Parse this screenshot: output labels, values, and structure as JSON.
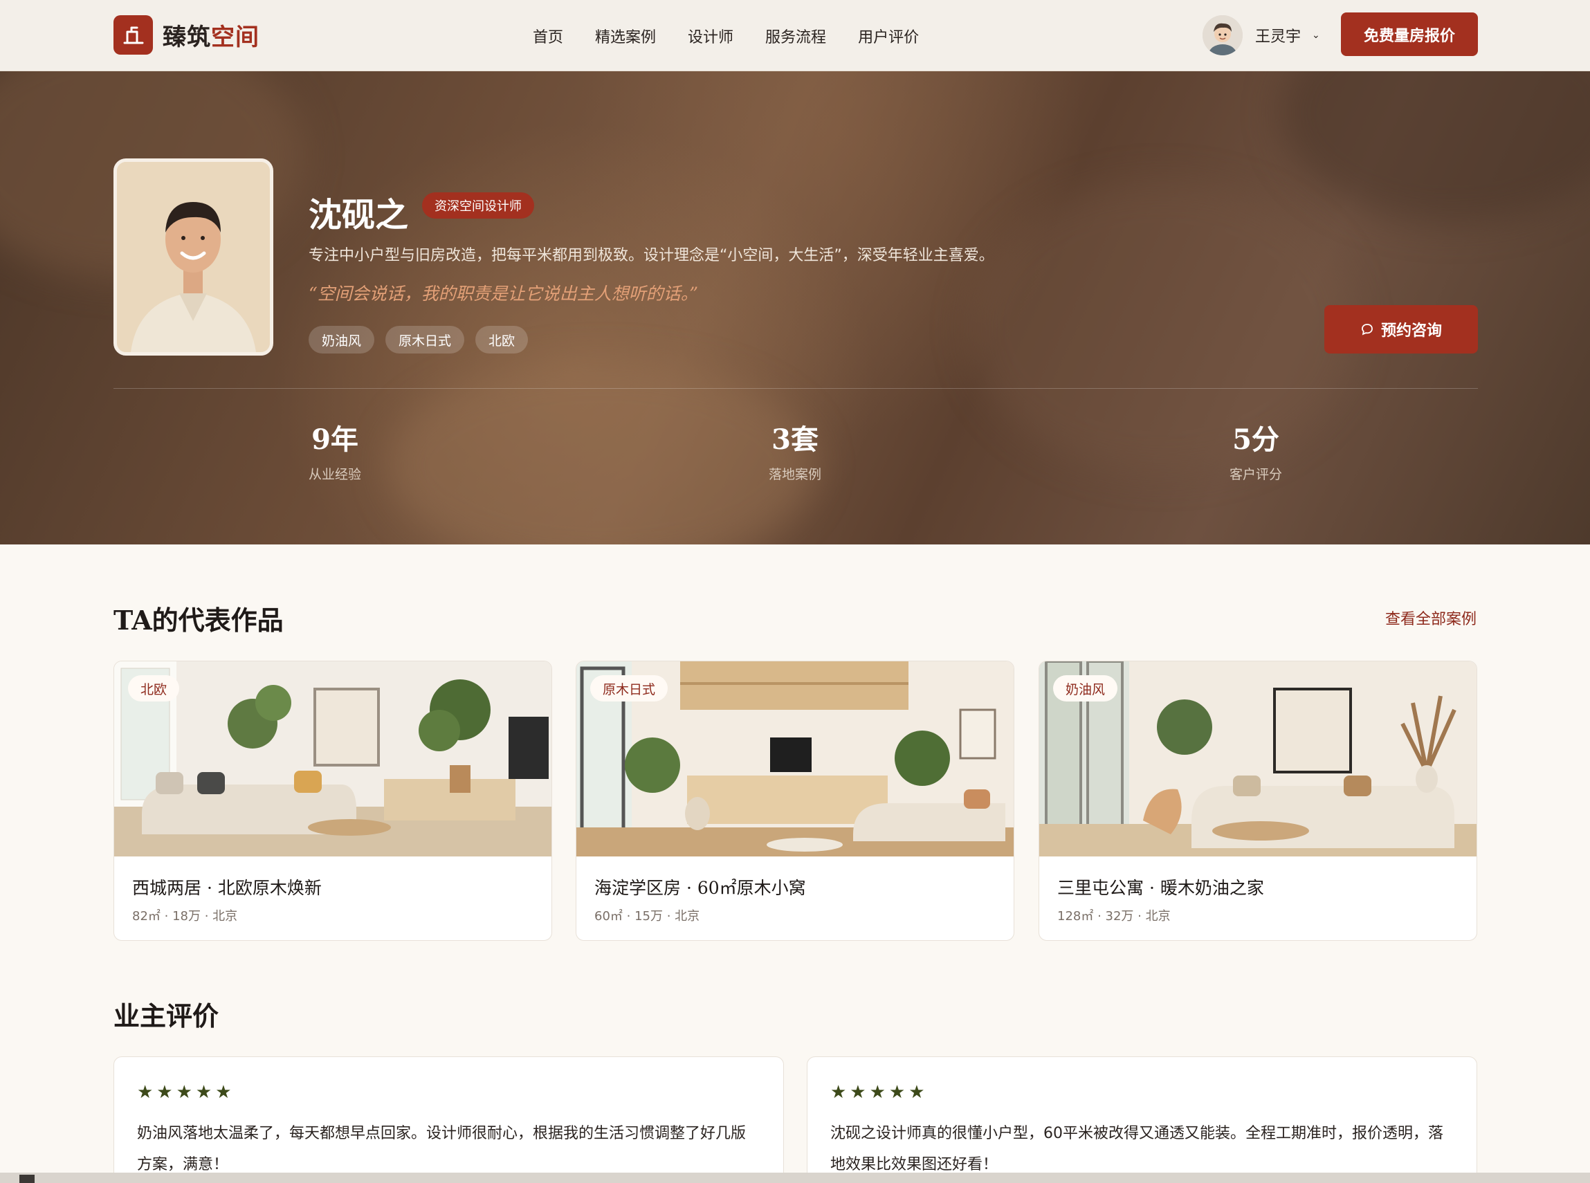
{
  "brand": {
    "name_part1": "臻筑",
    "name_part2": "空间"
  },
  "nav": {
    "items": [
      "首页",
      "精选案例",
      "设计师",
      "服务流程",
      "用户评价"
    ]
  },
  "user": {
    "name": "王灵宇",
    "avatar_icon": "user-avatar"
  },
  "header_cta": "免费量房报价",
  "designer": {
    "name": "沈砚之",
    "title": "资深空间设计师",
    "intro": "专注中小户型与旧房改造，把每平米都用到极致。设计理念是“小空间，大生活”，深受年轻业主喜爱。",
    "quote": "“空间会说话，我的职责是让它说出主人想听的话。”",
    "tags": [
      "奶油风",
      "原木日式",
      "北欧"
    ],
    "consult_button": "预约咨询",
    "stats": [
      {
        "value": "9年",
        "label": "从业经验"
      },
      {
        "value": "3套",
        "label": "落地案例"
      },
      {
        "value": "5分",
        "label": "客户评分"
      }
    ]
  },
  "works": {
    "title": "TA的代表作品",
    "see_all": "查看全部案例",
    "items": [
      {
        "tag": "北欧",
        "title": "西城两居 · 北欧原木焕新",
        "meta": "82㎡ · 18万 · 北京"
      },
      {
        "tag": "原木日式",
        "title": "海淀学区房 · 60㎡原木小窝",
        "meta": "60㎡ · 15万 · 北京"
      },
      {
        "tag": "奶油风",
        "title": "三里屯公寓 · 暖木奶油之家",
        "meta": "128㎡ · 32万 · 北京"
      }
    ]
  },
  "reviews": {
    "title": "业主评价",
    "items": [
      {
        "stars": "★★★★★",
        "text": "奶油风落地太温柔了，每天都想早点回家。设计师很耐心，根据我的生活习惯调整了好几版方案，满意！"
      },
      {
        "stars": "★★★★★",
        "text": "沈砚之设计师真的很懂小户型，60平米被改得又通透又能装。全程工期准时，报价透明，落地效果比效果图还好看！"
      }
    ]
  },
  "colors": {
    "accent": "#a3301f",
    "hero_brown": "#5e4332",
    "quote": "#e3a077",
    "star": "#3d4a1a"
  }
}
